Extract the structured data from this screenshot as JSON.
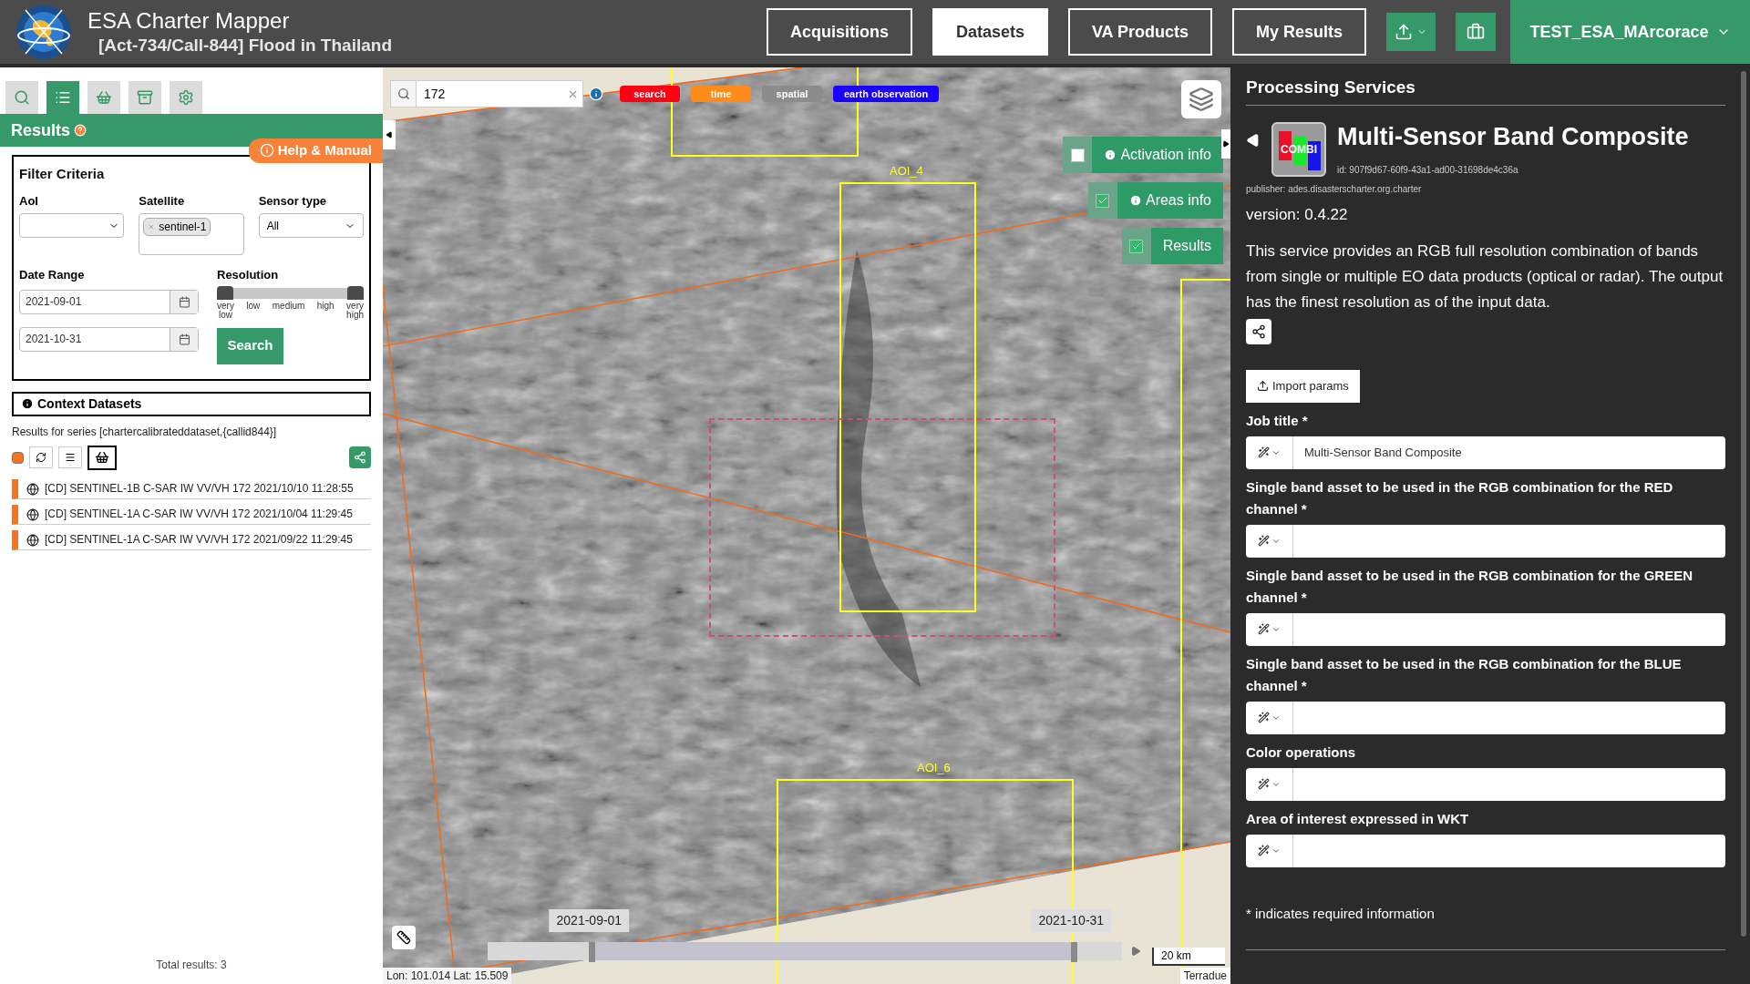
{
  "header": {
    "title": "ESA Charter Mapper",
    "subtitle": "[Act-734/Call-844] Flood in Thailand",
    "nav": [
      {
        "label": "Acquisitions",
        "selected": false
      },
      {
        "label": "Datasets",
        "selected": true
      },
      {
        "label": "VA Products",
        "selected": false
      },
      {
        "label": "My Results",
        "selected": false
      }
    ],
    "user": "TEST_ESA_MArcorace"
  },
  "sidebar": {
    "tabs": [
      {
        "kind": "search",
        "selected": false
      },
      {
        "kind": "list",
        "selected": true
      },
      {
        "kind": "basket",
        "selected": false
      },
      {
        "kind": "archive",
        "selected": false
      },
      {
        "kind": "settings",
        "selected": false
      }
    ],
    "help_link": "Help & Manual",
    "title": "Results",
    "filter": {
      "title": "Filter Criteria",
      "aoi_label": "AoI",
      "satellite_label": "Satellite",
      "satellite_tags": [
        "sentinel-1"
      ],
      "sensor_label": "Sensor type",
      "sensor_value": "All",
      "date_label": "Date Range",
      "date_start": "2021-09-01",
      "date_end": "2021-10-31",
      "resolution_label": "Resolution",
      "resolution_ticks": [
        "very low",
        "low",
        "medium",
        "high",
        "very high"
      ],
      "resolution_thumbs": [
        {
          "level": 0
        },
        {
          "level": 1
        }
      ],
      "search_button": "Search"
    },
    "context_title": "Context Datasets",
    "all_selected": true,
    "series": "Results for series [chartercalibrateddataset,{callid844}]",
    "items": [
      "[CD] SENTINEL-1B C-SAR IW VV/VH 172 2021/10/10 11:28:55",
      "[CD] SENTINEL-1A C-SAR IW VV/VH 172 2021/10/04 11:29:45",
      "[CD] SENTINEL-1A C-SAR IW VV/VH 172 2021/09/22 11:29:45"
    ],
    "total": "Total results: 3"
  },
  "map": {
    "search_value": "172",
    "chips": [
      {
        "label": "search",
        "color": "#ff0015"
      },
      {
        "label": "time",
        "color": "#ff8c1a"
      },
      {
        "label": "spatial",
        "color": "#8c8c8c"
      },
      {
        "label": "earth observation",
        "color": "#1a00ff"
      }
    ],
    "layers": [
      {
        "label": "Activation info",
        "checked": false,
        "info": true
      },
      {
        "label": "Areas info",
        "checked": true,
        "info": true
      },
      {
        "label": "Results",
        "checked": true,
        "info": false
      }
    ],
    "aoi_labels": [
      "AOI_4",
      "AOI_6"
    ],
    "timeline": {
      "start": "2021-09-01",
      "end": "2021-10-31",
      "thumbs": [
        {
          "level": 0.16
        },
        {
          "level": 0.92
        }
      ]
    },
    "coords": "Lon: 101.014 Lat: 15.509",
    "scale": "20 km",
    "attribution": "Terradue"
  },
  "panel": {
    "title": "Processing Services",
    "service": "Multi-Sensor Band Composite",
    "icon_text": "COMBI",
    "id": "id: 907f9d67-60f9-43a1-ad00-31698de4c36a",
    "publisher": "publisher: ades.disasterscharter.org.charter",
    "version": "version: 0.4.22",
    "description": "This service provides an RGB full resolution combination of bands from single or multiple EO data products (optical or radar). The output has the finest resolution as of the input data.",
    "import_button": "Import params",
    "fields": [
      {
        "label": "Job title *",
        "value": "Multi-Sensor Band Composite"
      },
      {
        "label": "Single band asset to be used in the RGB combination for the RED channel *"
      },
      {
        "label": "Single band asset to be used in the RGB combination for the GREEN channel *"
      },
      {
        "label": "Single band asset to be used in the RGB combination for the BLUE channel *"
      },
      {
        "label": "Color operations"
      },
      {
        "label": "Area of interest expressed in WKT"
      }
    ],
    "footnote": "* indicates required information"
  }
}
